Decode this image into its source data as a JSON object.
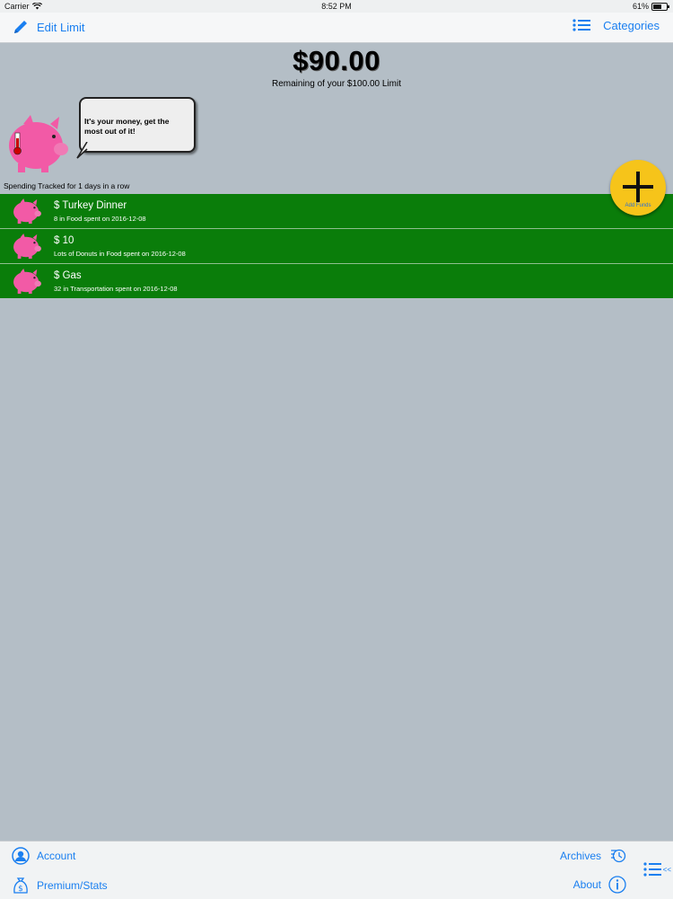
{
  "status_bar": {
    "carrier": "Carrier",
    "time": "8:52 PM",
    "battery": "61%"
  },
  "nav": {
    "left_label": "Edit Limit",
    "right_label": "Categories"
  },
  "balance": {
    "amount": "$90.00",
    "subtitle": "Remaining of your $100.00 Limit"
  },
  "bubble": {
    "text": "It's your money, get the most out of it!"
  },
  "streak": {
    "text": "Spending Tracked for 1 days in a row"
  },
  "add_button": {
    "label": "Add Funds"
  },
  "expenses": [
    {
      "title": "$ Turkey Dinner",
      "detail": "8 in Food spent on 2016-12-08"
    },
    {
      "title": "$ 10",
      "detail": "Lots of Donuts in Food spent on 2016-12-08"
    },
    {
      "title": "$ Gas",
      "detail": "32 in Transportation spent on 2016-12-08"
    }
  ],
  "toolbar": {
    "account": "Account",
    "premium": "Premium/Stats",
    "archives": "Archives",
    "about": "About",
    "side_arrow": "<<"
  },
  "colors": {
    "background": "#b4bec6",
    "accent": "#1a7ff0",
    "list_green": "#0a7d0a",
    "pig_pink": "#f25aa6",
    "add_yellow": "#f6c41a"
  }
}
